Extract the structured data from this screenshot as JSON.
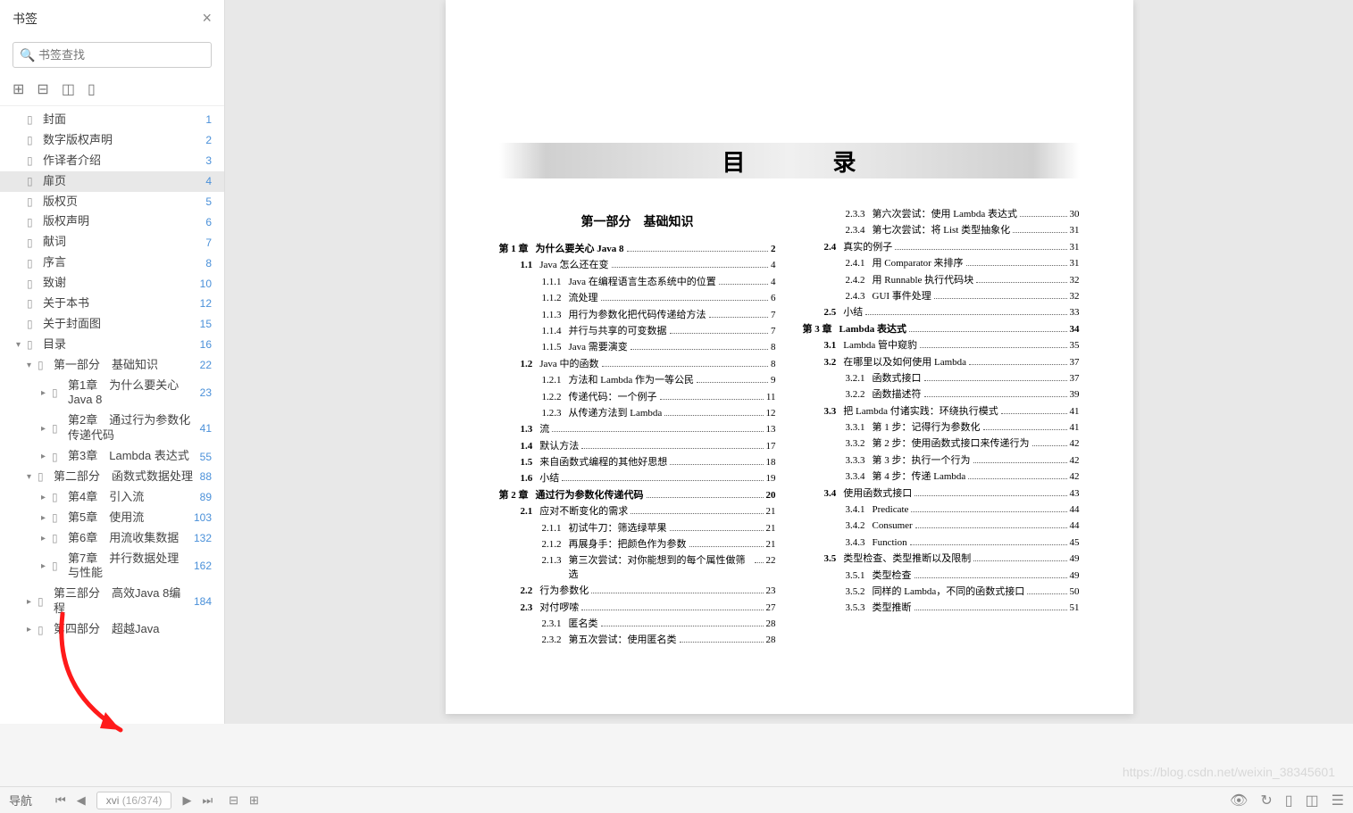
{
  "sidebar": {
    "title": "书签",
    "search_placeholder": "书签查找",
    "items": [
      {
        "label": "封面",
        "page": "1",
        "level": 0
      },
      {
        "label": "数字版权声明",
        "page": "2",
        "level": 0
      },
      {
        "label": "作译者介绍",
        "page": "3",
        "level": 0
      },
      {
        "label": "扉页",
        "page": "4",
        "level": 0,
        "selected": true
      },
      {
        "label": "版权页",
        "page": "5",
        "level": 0
      },
      {
        "label": "版权声明",
        "page": "6",
        "level": 0
      },
      {
        "label": "献词",
        "page": "7",
        "level": 0
      },
      {
        "label": "序言",
        "page": "8",
        "level": 0
      },
      {
        "label": "致谢",
        "page": "10",
        "level": 0
      },
      {
        "label": "关于本书",
        "page": "12",
        "level": 0
      },
      {
        "label": "关于封面图",
        "page": "15",
        "level": 0
      },
      {
        "label": "目录",
        "page": "16",
        "level": 0,
        "expanded": true
      },
      {
        "label": "第一部分　基础知识",
        "page": "22",
        "level": 1,
        "expanded": true
      },
      {
        "label": "第1章　为什么要关心Java 8",
        "page": "23",
        "level": 2,
        "chev": true
      },
      {
        "label": "第2章　通过行为参数化传递代码",
        "page": "41",
        "level": 2,
        "chev": true
      },
      {
        "label": "第3章　Lambda 表达式",
        "page": "55",
        "level": 2,
        "chev": true
      },
      {
        "label": "第二部分　函数式数据处理",
        "page": "88",
        "level": 1,
        "expanded": true
      },
      {
        "label": "第4章　引入流",
        "page": "89",
        "level": 2,
        "chev": true
      },
      {
        "label": "第5章　使用流",
        "page": "103",
        "level": 2,
        "chev": true
      },
      {
        "label": "第6章　用流收集数据",
        "page": "132",
        "level": 2,
        "chev": true
      },
      {
        "label": "第7章　并行数据处理与性能",
        "page": "162",
        "level": 2,
        "chev": true
      },
      {
        "label": "第三部分　高效Java 8编程",
        "page": "184",
        "level": 1,
        "chev": true
      },
      {
        "label": "第四部分　超越Java",
        "page": "",
        "level": 1,
        "chev": true
      }
    ]
  },
  "page_nav": {
    "current": "xvi",
    "position": "(16/374)"
  },
  "nav_label": "导航",
  "watermark": "https://blog.csdn.net/weixin_38345601",
  "toc": {
    "heading": "目　录",
    "left": [
      {
        "cls": "part",
        "text": "第一部分　基础知识"
      },
      {
        "cls": "ch",
        "num": "第 1 章",
        "text": "为什么要关心 Java 8",
        "pg": "2"
      },
      {
        "cls": "sec",
        "num": "1.1",
        "text": "Java 怎么还在变",
        "pg": "4"
      },
      {
        "cls": "sub",
        "num": "1.1.1",
        "text": "Java 在编程语言生态系统中的位置",
        "pg": "4"
      },
      {
        "cls": "sub",
        "num": "1.1.2",
        "text": "流处理",
        "pg": "6"
      },
      {
        "cls": "sub",
        "num": "1.1.3",
        "text": "用行为参数化把代码传递给方法",
        "pg": "7"
      },
      {
        "cls": "sub",
        "num": "1.1.4",
        "text": "并行与共享的可变数据",
        "pg": "7"
      },
      {
        "cls": "sub",
        "num": "1.1.5",
        "text": "Java 需要演变",
        "pg": "8"
      },
      {
        "cls": "sec",
        "num": "1.2",
        "text": "Java 中的函数",
        "pg": "8"
      },
      {
        "cls": "sub",
        "num": "1.2.1",
        "text": "方法和 Lambda 作为一等公民",
        "pg": "9"
      },
      {
        "cls": "sub",
        "num": "1.2.2",
        "text": "传递代码：一个例子",
        "pg": "11"
      },
      {
        "cls": "sub",
        "num": "1.2.3",
        "text": "从传递方法到 Lambda",
        "pg": "12"
      },
      {
        "cls": "sec",
        "num": "1.3",
        "text": "流",
        "pg": "13"
      },
      {
        "cls": "sec",
        "num": "1.4",
        "text": "默认方法",
        "pg": "17"
      },
      {
        "cls": "sec",
        "num": "1.5",
        "text": "来自函数式编程的其他好思想",
        "pg": "18"
      },
      {
        "cls": "sec",
        "num": "1.6",
        "text": "小结",
        "pg": "19"
      },
      {
        "cls": "ch",
        "num": "第 2 章",
        "text": "通过行为参数化传递代码",
        "pg": "20"
      },
      {
        "cls": "sec",
        "num": "2.1",
        "text": "应对不断变化的需求",
        "pg": "21"
      },
      {
        "cls": "sub",
        "num": "2.1.1",
        "text": "初试牛刀：筛选绿苹果",
        "pg": "21"
      },
      {
        "cls": "sub",
        "num": "2.1.2",
        "text": "再展身手：把颜色作为参数",
        "pg": "21"
      },
      {
        "cls": "sub",
        "num": "2.1.3",
        "text": "第三次尝试：对你能想到的每个属性做筛选",
        "pg": "22"
      },
      {
        "cls": "sec",
        "num": "2.2",
        "text": "行为参数化",
        "pg": "23"
      },
      {
        "cls": "sec",
        "num": "2.3",
        "text": "对付啰嗦",
        "pg": "27"
      },
      {
        "cls": "sub",
        "num": "2.3.1",
        "text": "匿名类",
        "pg": "28"
      },
      {
        "cls": "sub",
        "num": "2.3.2",
        "text": "第五次尝试：使用匿名类",
        "pg": "28"
      }
    ],
    "right": [
      {
        "cls": "sub",
        "num": "2.3.3",
        "text": "第六次尝试：使用 Lambda 表达式",
        "pg": "30"
      },
      {
        "cls": "sub",
        "num": "2.3.4",
        "text": "第七次尝试：将 List 类型抽象化",
        "pg": "31"
      },
      {
        "cls": "sec",
        "num": "2.4",
        "text": "真实的例子",
        "pg": "31"
      },
      {
        "cls": "sub",
        "num": "2.4.1",
        "text": "用 Comparator 来排序",
        "pg": "31"
      },
      {
        "cls": "sub",
        "num": "2.4.2",
        "text": "用 Runnable 执行代码块",
        "pg": "32"
      },
      {
        "cls": "sub",
        "num": "2.4.3",
        "text": "GUI 事件处理",
        "pg": "32"
      },
      {
        "cls": "sec",
        "num": "2.5",
        "text": "小结",
        "pg": "33"
      },
      {
        "cls": "ch",
        "num": "第 3 章",
        "text": "Lambda 表达式",
        "pg": "34"
      },
      {
        "cls": "sec",
        "num": "3.1",
        "text": "Lambda 管中窥豹",
        "pg": "35"
      },
      {
        "cls": "sec",
        "num": "3.2",
        "text": "在哪里以及如何使用 Lambda",
        "pg": "37"
      },
      {
        "cls": "sub",
        "num": "3.2.1",
        "text": "函数式接口",
        "pg": "37"
      },
      {
        "cls": "sub",
        "num": "3.2.2",
        "text": "函数描述符",
        "pg": "39"
      },
      {
        "cls": "sec",
        "num": "3.3",
        "text": "把 Lambda 付诸实践：环绕执行模式",
        "pg": "41"
      },
      {
        "cls": "sub",
        "num": "3.3.1",
        "text": "第 1 步：记得行为参数化",
        "pg": "41"
      },
      {
        "cls": "sub",
        "num": "3.3.2",
        "text": "第 2 步：使用函数式接口来传递行为",
        "pg": "42"
      },
      {
        "cls": "sub",
        "num": "3.3.3",
        "text": "第 3 步：执行一个行为",
        "pg": "42"
      },
      {
        "cls": "sub",
        "num": "3.3.4",
        "text": "第 4 步：传递 Lambda",
        "pg": "42"
      },
      {
        "cls": "sec",
        "num": "3.4",
        "text": "使用函数式接口",
        "pg": "43"
      },
      {
        "cls": "sub",
        "num": "3.4.1",
        "text": "Predicate",
        "pg": "44"
      },
      {
        "cls": "sub",
        "num": "3.4.2",
        "text": "Consumer",
        "pg": "44"
      },
      {
        "cls": "sub",
        "num": "3.4.3",
        "text": "Function",
        "pg": "45"
      },
      {
        "cls": "sec",
        "num": "3.5",
        "text": "类型检查、类型推断以及限制",
        "pg": "49"
      },
      {
        "cls": "sub",
        "num": "3.5.1",
        "text": "类型检查",
        "pg": "49"
      },
      {
        "cls": "sub",
        "num": "3.5.2",
        "text": "同样的 Lambda，不同的函数式接口",
        "pg": "50"
      },
      {
        "cls": "sub",
        "num": "3.5.3",
        "text": "类型推断",
        "pg": "51"
      }
    ]
  }
}
